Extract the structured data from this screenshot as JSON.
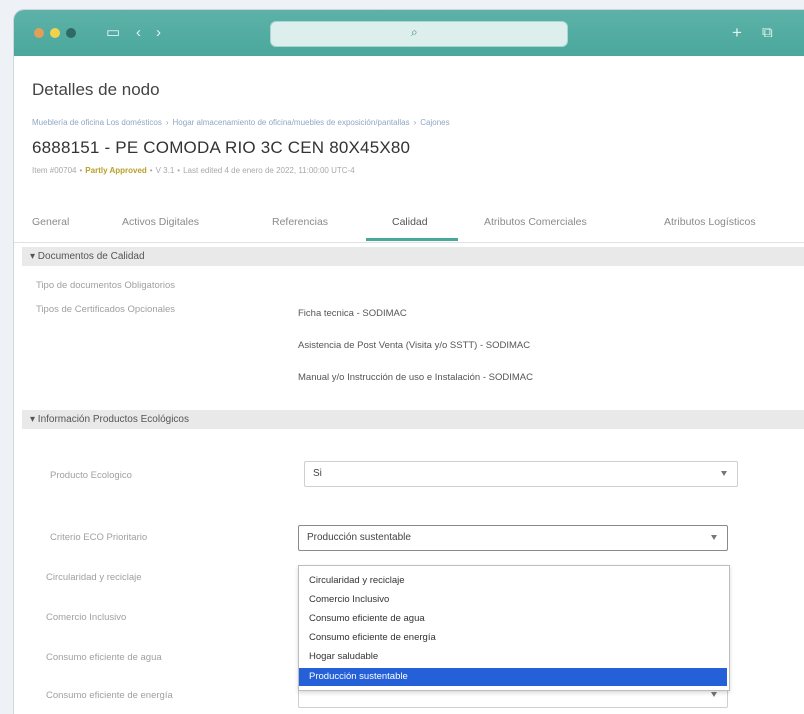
{
  "header": {
    "title": "Detalles de nodo",
    "breadcrumb": [
      "Mueblería de oficina Los domésticos",
      "Hogar almacenamiento de oficina/muebles de exposición/pantallas",
      "Cajones"
    ],
    "product_title": "6888151 - PE COMODA RIO 3C CEN 80X45X80",
    "meta": {
      "code": "Item #00704",
      "status": "Partly Approved",
      "version": "V 3.1",
      "updated": "Last edited 4 de enero de 2022, 11:00:00 UTC-4"
    }
  },
  "tabs": [
    {
      "label": "General"
    },
    {
      "label": "Activos Digitales"
    },
    {
      "label": "Referencias"
    },
    {
      "label": "Calidad"
    },
    {
      "label": "Atributos Comerciales"
    },
    {
      "label": "Atributos Logísticos"
    }
  ],
  "quality_docs": {
    "section_title": "▾ Documentos de Calidad",
    "mandatory_label": "Tipo de documentos Obligatorios",
    "optional_label": "Tipos de Certificados Opcionales",
    "optional_values": [
      "Ficha tecnica - SODIMAC",
      "Asistencia de Post Venta (Visita y/o SSTT) - SODIMAC",
      "Manual y/o Instrucción de uso e Instalación - SODIMAC"
    ]
  },
  "eco": {
    "section_title": "▾ Información Productos Ecológicos",
    "producto_label": "Producto Ecologico",
    "producto_value": "Si",
    "criterio_label": "Criterio ECO Prioritario",
    "criterio_value": "Producción sustentable",
    "rows": [
      {
        "label": "Circularidad y reciclaje"
      },
      {
        "label": "Comercio Inclusivo"
      },
      {
        "label": "Consumo eficiente de agua"
      },
      {
        "label": "Consumo eficiente de energía"
      }
    ],
    "dropdown_options": [
      "Circularidad y reciclaje",
      "Comercio Inclusivo",
      "Consumo eficiente de agua",
      "Consumo eficiente de energía",
      "Hogar saludable",
      "Producción sustentable"
    ],
    "dropdown_selected_index": 5
  },
  "colors": {
    "titlebar": "#4aa79c",
    "accent": "#4aa79c",
    "selected_option": "#2460d8",
    "status": "#b8a02a"
  },
  "icons": [
    "sidebar-icon",
    "back-icon",
    "forward-icon",
    "search-icon",
    "plus-icon",
    "copy-icon",
    "caret-down-icon"
  ]
}
